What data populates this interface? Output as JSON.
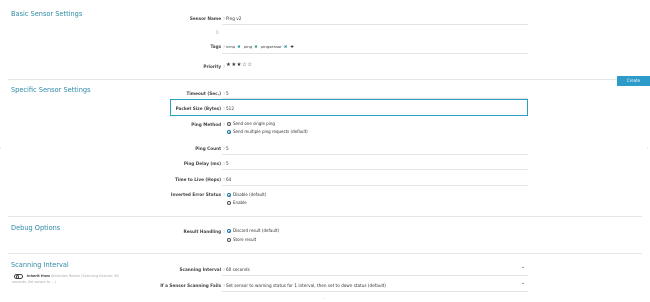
{
  "sections": {
    "basic": "Basic Sensor Settings",
    "specific": "Specific Sensor Settings",
    "debug": "Debug Options",
    "scanning": "Scanning Interval"
  },
  "help_icon": "?",
  "fields": {
    "sensor_name": {
      "label": "Sensor Name",
      "value": "Ping v2"
    },
    "parent_tags": {
      "label": "",
      "value": "0"
    },
    "tags": {
      "label": "Tags",
      "items": [
        "icmp",
        "ping",
        "pingsensor"
      ],
      "remove": "✖",
      "add": "✚"
    },
    "priority": {
      "label": "Priority",
      "stars": "★★★☆☆"
    },
    "timeout": {
      "label": "Timeout (Sec.)",
      "value": "5"
    },
    "packet_size": {
      "label": "Packet Size (Bytes)",
      "value": "512"
    },
    "ping_method": {
      "label": "Ping Method",
      "options": [
        "Send one single ping",
        "Send multiple ping requests (default)"
      ],
      "selected": 1
    },
    "ping_count": {
      "label": "Ping Count",
      "value": "5"
    },
    "ping_delay": {
      "label": "Ping Delay (ms)",
      "value": "5"
    },
    "ttl": {
      "label": "Time to Live (Hops)",
      "value": "64"
    },
    "inverted": {
      "label": "Inverted Error Status",
      "options": [
        "Disable (default)",
        "Enable"
      ],
      "selected": 0
    },
    "result_handling": {
      "label": "Result Handling",
      "options": [
        "Discard result (default)",
        "Store result"
      ],
      "selected": 0
    },
    "scanning_interval": {
      "label": "Scanning Interval",
      "value": "60 seconds"
    },
    "scanning_fails": {
      "label": "If a Sensor Scanning Fails",
      "value": "Set sensor to warning status for 1 interval, then set to down status (default)"
    }
  },
  "inherit": {
    "text_line1": "inherit from",
    "text_line1_faded": "Attributes Router (Scanning Interval: 60",
    "text_line2": "seconds, Set sensor to ...)"
  },
  "buttons": {
    "create": "Create"
  },
  "chevron": "⌄"
}
